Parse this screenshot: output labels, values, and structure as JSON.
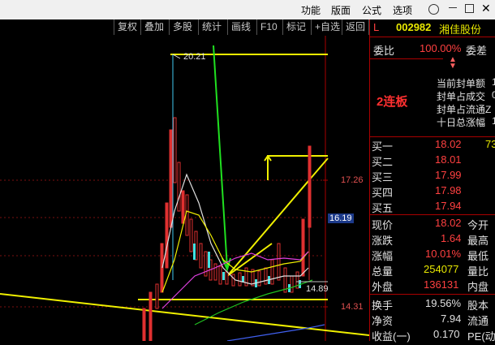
{
  "menu": {
    "items": [
      "功能",
      "版面",
      "公式",
      "选项"
    ]
  },
  "toolbar": {
    "buttons": [
      "复权",
      "叠加",
      "多股",
      "统计",
      "画线",
      "F10",
      "标记",
      "+自选",
      "返回"
    ]
  },
  "chart": {
    "high_label": "20.21",
    "low_label": "14.89",
    "y_labels": [
      "17.26",
      "14.31"
    ],
    "current_badge": "16.19"
  },
  "panel": {
    "flag": "L",
    "code": "002982",
    "name": "湘佳股份",
    "weibi_label": "委比",
    "weibi_value": "100.00%",
    "weicha_label": "委差",
    "seal_lines": [
      "当前封单额",
      "封单占成交",
      "封单占流通Z",
      "十日总涨幅"
    ],
    "seal_values": [
      "1",
      "0",
      "",
      "1"
    ],
    "streak": "2连板",
    "bids": [
      {
        "label": "买一",
        "price": "18.02",
        "vol": "73"
      },
      {
        "label": "买二",
        "price": "18.01",
        "vol": ""
      },
      {
        "label": "买三",
        "price": "17.99",
        "vol": ""
      },
      {
        "label": "买四",
        "price": "17.98",
        "vol": ""
      },
      {
        "label": "买五",
        "price": "17.94",
        "vol": ""
      }
    ],
    "quote": [
      {
        "label": "现价",
        "value": "18.02",
        "label2": "今开",
        "color": "red"
      },
      {
        "label": "涨跌",
        "value": "1.64",
        "label2": "最高",
        "color": "red"
      },
      {
        "label": "涨幅",
        "value": "10.01%",
        "label2": "最低",
        "color": "red"
      },
      {
        "label": "总量",
        "value": "254077",
        "label2": "量比",
        "color": "yel"
      },
      {
        "label": "外盘",
        "value": "136131",
        "label2": "内盘",
        "color": "red"
      }
    ],
    "stats": [
      {
        "label": "换手",
        "value": "19.56%",
        "label2": "股本"
      },
      {
        "label": "净资",
        "value": "7.94",
        "label2": "流通"
      },
      {
        "label": "收益(一)",
        "value": "0.170",
        "label2": "PE(动"
      }
    ]
  }
}
